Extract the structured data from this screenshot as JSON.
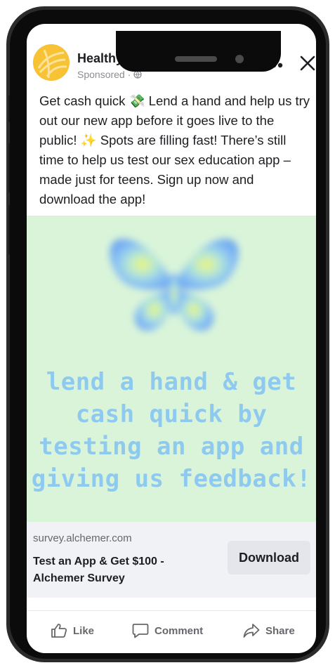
{
  "post": {
    "page_name": "Healthy Teen Network",
    "sponsored_label": "Sponsored",
    "separator": "·",
    "body_text": "Get cash quick 💸 Lend a hand and help us try out our new app before it goes live to the public! ✨ Spots are filling fast! There’s still time to help us test our sex education app – made just for teens. Sign up now and download the app!"
  },
  "ad_image": {
    "caption": "lend a hand & get cash quick by testing an app and giving us feedback!",
    "background_color": "#d9f4d9",
    "caption_color": "#8ec9ef",
    "icon": "butterfly-icon"
  },
  "link": {
    "domain": "survey.alchemer.com",
    "title": "Test an App & Get $100 - Alchemer Survey",
    "cta_label": "Download"
  },
  "actions": {
    "like_label": "Like",
    "comment_label": "Comment",
    "share_label": "Share"
  },
  "icons": [
    "avatar-logo",
    "globe-icon",
    "more-icon",
    "close-icon",
    "butterfly-icon",
    "like-icon",
    "comment-icon",
    "share-icon"
  ]
}
